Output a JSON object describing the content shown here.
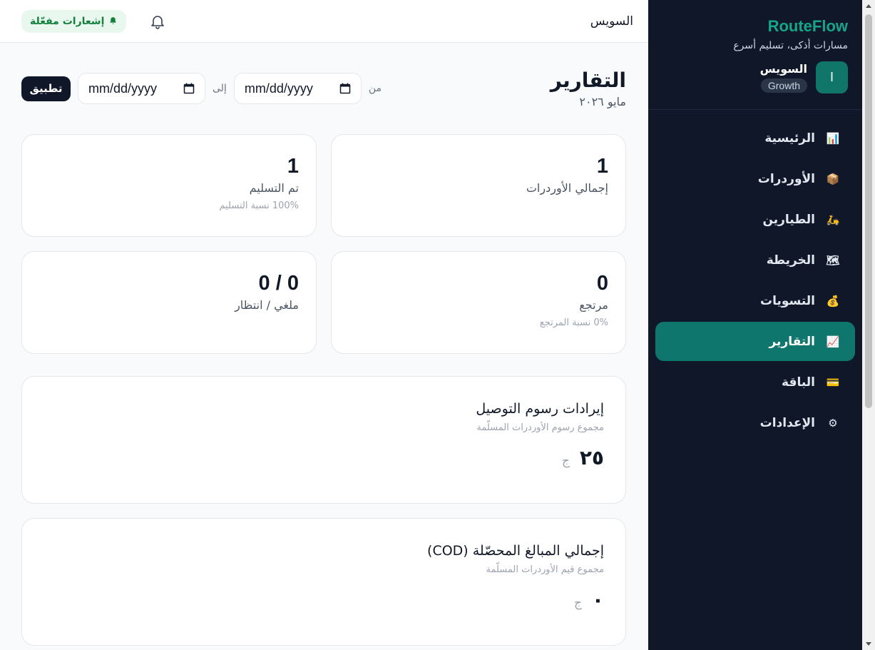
{
  "brand": {
    "name": "RouteFlow",
    "tagline": "مسارات أذكى، تسليم أسرع"
  },
  "account": {
    "avatar_letter": "I",
    "name": "السويس",
    "plan": "Growth"
  },
  "nav": [
    {
      "label": "الرئيسية",
      "icon": "bar-chart-icon",
      "glyph": "📊",
      "active": false
    },
    {
      "label": "الأوردرات",
      "icon": "package-icon",
      "glyph": "📦",
      "active": false
    },
    {
      "label": "الطيارين",
      "icon": "scooter-icon",
      "glyph": "🛵",
      "active": false
    },
    {
      "label": "الخريطة",
      "icon": "map-icon",
      "glyph": "🗺",
      "active": false
    },
    {
      "label": "التسويات",
      "icon": "money-bag-icon",
      "glyph": "💰",
      "active": false
    },
    {
      "label": "التقارير",
      "icon": "trend-chart-icon",
      "glyph": "📈",
      "active": true
    },
    {
      "label": "الباقة",
      "icon": "credit-card-icon",
      "glyph": "💳",
      "active": false
    },
    {
      "label": "الإعدادات",
      "icon": "gear-icon",
      "glyph": "⚙",
      "active": false
    }
  ],
  "topbar": {
    "city": "السويس",
    "notifications_label": "إشعارات مفعّلة"
  },
  "page": {
    "title": "التقارير",
    "subtitle": "مايو ٢٠٢٦"
  },
  "filters": {
    "from_label": "من",
    "to_label": "إلى",
    "from_value": "mm/dd/yyyy",
    "to_value": "mm/dd/yyyy",
    "apply_label": "تطبيق"
  },
  "stats": {
    "total_orders": {
      "value": "1",
      "label": "إجمالي الأوردرات"
    },
    "delivered": {
      "value": "1",
      "label": "تم التسليم",
      "sub": "100% نسبة التسليم"
    },
    "returned": {
      "value": "0",
      "label": "مرتجع",
      "sub": "0% نسبة المرتجع"
    },
    "cancelled_pending": {
      "value": "0 / 0",
      "label": "ملغي / انتظار"
    }
  },
  "revenue": {
    "title": "إيرادات رسوم التوصيل",
    "subtitle": "مجموع رسوم الأوردرات المسلّمة",
    "value": "٢٥",
    "currency": "ج"
  },
  "cod": {
    "title": "إجمالي المبالغ المحصّلة (COD)",
    "subtitle": "مجموع قيم الأوردرات المسلّمة",
    "value": "٠",
    "currency": "ج"
  },
  "colors": {
    "sidebar_bg": "#0f1729",
    "accent": "#0f766e",
    "brand": "#17a589",
    "notif_bg": "#e8f8ee"
  }
}
